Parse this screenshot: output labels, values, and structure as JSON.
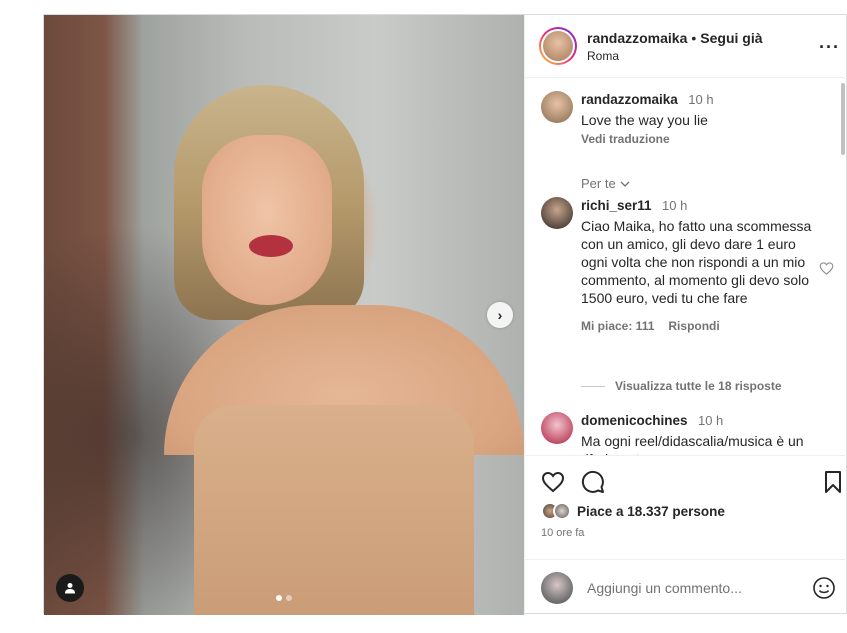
{
  "post": {
    "image_alt": "",
    "carousel": {
      "count": 2,
      "active_index": 0
    }
  },
  "header": {
    "username": "randazzomaika",
    "separator": "•",
    "follow_label": "Segui già",
    "location": "Roma",
    "more_icon": "more-horizontal-icon"
  },
  "comments": [
    {
      "username": "randazzomaika",
      "time": "10 h",
      "text": "Love the way you lie",
      "translate_label": "Vedi traduzione"
    },
    {
      "username": "richi_ser11",
      "time": "10 h",
      "text": "Ciao Maika, ho fatto una scommessa con un amico, gli devo dare 1 euro ogni volta che non rispondi a un mio commento, al momento gli devo solo 1500 euro, vedi tu che fare",
      "likes_label": "Mi piace: 111",
      "reply_label": "Rispondi"
    },
    {
      "username": "domenicochines",
      "time": "10 h",
      "text": "Ma ogni reel/didascalia/musica è un riferimento a"
    }
  ],
  "filter_label": "Per te",
  "view_replies_label": "Visualizza tutte le 18 risposte",
  "likes_text": "Piace a 18.337 persone",
  "post_time": "10 ore fa",
  "add_comment_placeholder": "Aggiungi un commento...",
  "colors": {
    "text": "#262626",
    "muted": "#737373",
    "border": "#dbdbdb",
    "story_ring": [
      "#f9ce34",
      "#ee2a7b",
      "#6228d7"
    ]
  }
}
